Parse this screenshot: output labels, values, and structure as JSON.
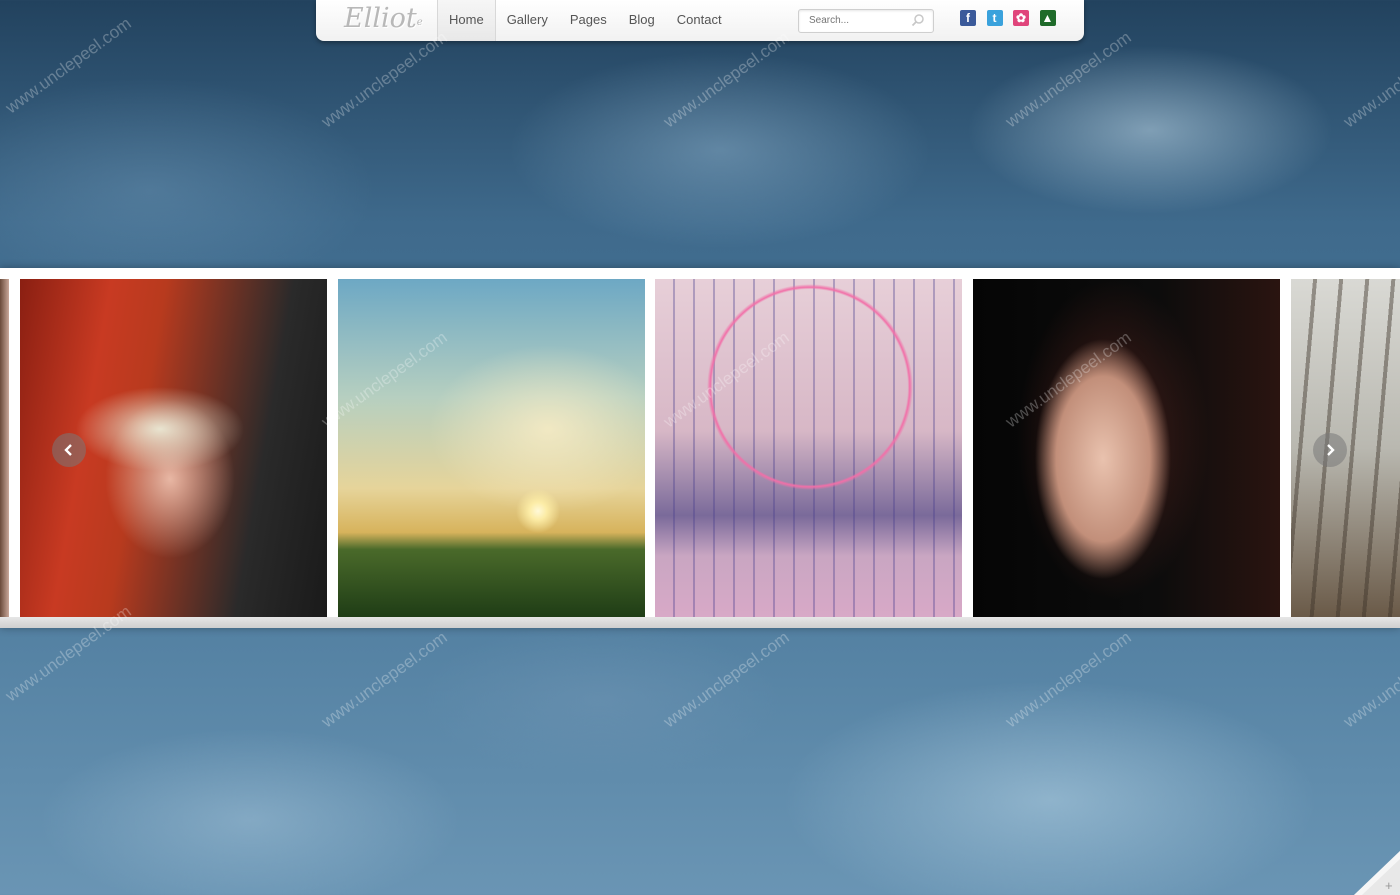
{
  "logo": {
    "text": "Elliot",
    "mark": "e"
  },
  "nav": {
    "items": [
      {
        "label": "Home",
        "active": true
      },
      {
        "label": "Gallery",
        "active": false
      },
      {
        "label": "Pages",
        "active": false
      },
      {
        "label": "Blog",
        "active": false
      },
      {
        "label": "Contact",
        "active": false
      }
    ]
  },
  "search": {
    "placeholder": "Search..."
  },
  "social": [
    "facebook-icon",
    "twitter-icon",
    "dribbble-icon",
    "forrst-icon"
  ],
  "watermark": "www.unclepeel.com",
  "gallery": {
    "photos": [
      "partial-photo-left",
      "woman-red-hair-shutter-glasses",
      "sunset-over-cornfield-with-plane",
      "london-eye-tree-lights",
      "woman-portrait-dark-hair",
      "foggy-forest-partial"
    ]
  },
  "colors": {
    "accent_bar": "#ffffff",
    "nav_text": "#555555"
  }
}
